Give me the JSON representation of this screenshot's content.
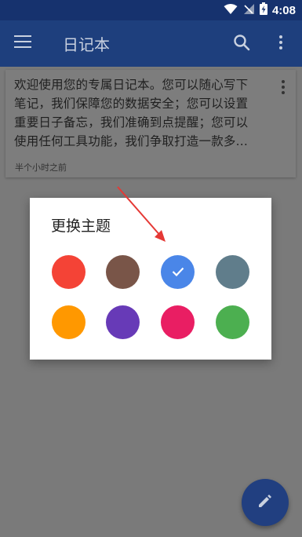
{
  "status_bar": {
    "time": "4:08"
  },
  "app_bar": {
    "title": "日记本"
  },
  "note": {
    "preview_lines": [
      "欢迎使用您的专属日记本。您可以随心写下",
      "笔记，我们保障您的数据安全；您可以设置",
      "重要日子备忘，我们准确到点提醒；您可以",
      "使用任何工具功能，我们争取打造一款多..."
    ],
    "time": "半个小时之前"
  },
  "dialog": {
    "title": "更换主题",
    "colors": [
      {
        "name": "red",
        "hex": "#f44336"
      },
      {
        "name": "brown",
        "hex": "#795548"
      },
      {
        "name": "blue",
        "hex": "#4a86e8",
        "selected": true
      },
      {
        "name": "blue-grey",
        "hex": "#607d8b"
      },
      {
        "name": "orange",
        "hex": "#ff9800"
      },
      {
        "name": "purple",
        "hex": "#673ab7"
      },
      {
        "name": "pink",
        "hex": "#e91e63"
      },
      {
        "name": "green",
        "hex": "#4caf50"
      }
    ]
  },
  "colors": {
    "primary_dark": "#16326e",
    "primary": "#1e3f7d",
    "fab": "#213f80",
    "annotation_arrow": "#e53935"
  }
}
